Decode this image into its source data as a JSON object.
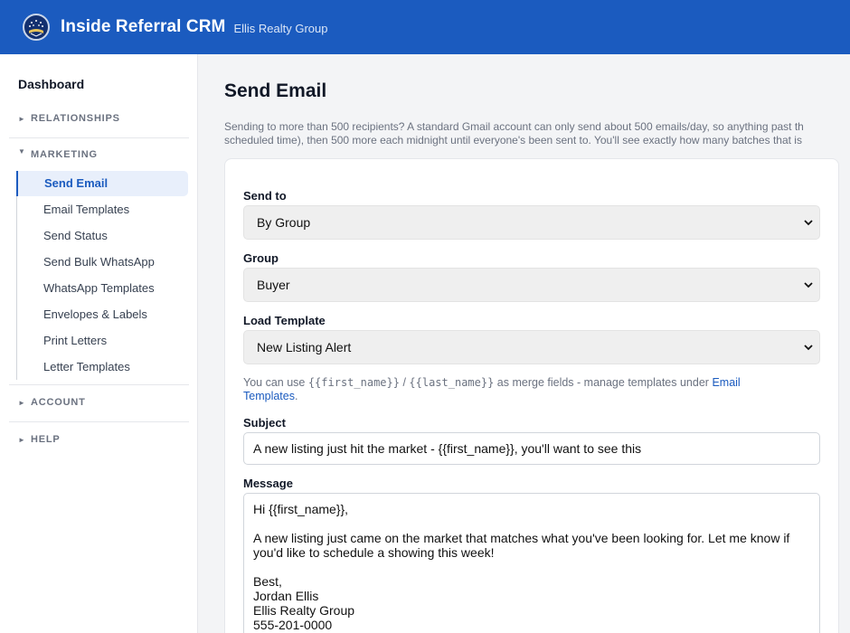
{
  "header": {
    "app_title": "Inside Referral CRM",
    "org_name": "Ellis Realty Group",
    "colors": {
      "brand": "#1b5bbf",
      "brand_dark": "#13306f"
    }
  },
  "sidebar": {
    "dashboard": "Dashboard",
    "sections": {
      "relationships": "RELATIONSHIPS",
      "marketing": "MARKETING",
      "account": "ACCOUNT",
      "help": "HELP"
    },
    "marketing_items": [
      {
        "label": "Send Email",
        "active": true
      },
      {
        "label": "Email Templates"
      },
      {
        "label": "Send Status"
      },
      {
        "label": "Send Bulk WhatsApp"
      },
      {
        "label": "WhatsApp Templates"
      },
      {
        "label": "Envelopes & Labels"
      },
      {
        "label": "Print Letters"
      },
      {
        "label": "Letter Templates"
      }
    ]
  },
  "main": {
    "title": "Send Email",
    "notice_line1": "Sending to more than 500 recipients? A standard Gmail account can only send about 500 emails/day, so anything past th",
    "notice_line2": "scheduled time), then 500 more each midnight until everyone's been sent to. You'll see exactly how many batches that is",
    "form": {
      "send_to_label": "Send to",
      "send_to_value": "By Group",
      "group_label": "Group",
      "group_value": "Buyer",
      "template_label": "Load Template",
      "template_value": "New Listing Alert",
      "hint_prefix": "You can use ",
      "hint_field1": "{{first_name}}",
      "hint_sep": " / ",
      "hint_field2": "{{last_name}}",
      "hint_middle": " as merge fields - manage templates under ",
      "hint_link": "Email Templates",
      "hint_suffix": ".",
      "subject_label": "Subject",
      "subject_value": "A new listing just hit the market - {{first_name}}, you'll want to see this",
      "message_label": "Message",
      "message_lines": [
        "Hi {{first_name}},",
        "",
        "A new listing just came on the market that matches what you've been looking for. Let me know if",
        "you'd like to schedule a showing this week!",
        "",
        "Best,",
        "Jordan Ellis",
        "Ellis Realty Group",
        "555-201-0000"
      ]
    }
  }
}
